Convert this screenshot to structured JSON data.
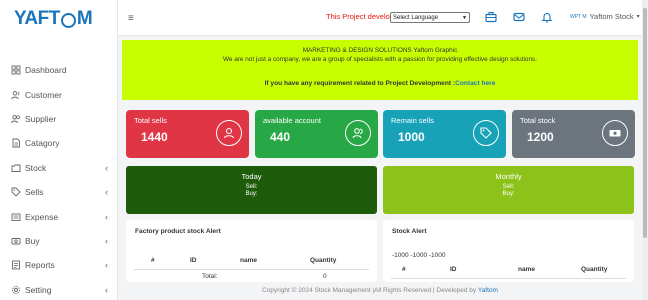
{
  "brand": {
    "logo_pre": "YAFT",
    "logo_post": "M"
  },
  "sidebar": {
    "items": [
      {
        "label": "Dashboard",
        "icon": "dashboard-icon",
        "has_chevron": false
      },
      {
        "label": "Customer",
        "icon": "customer-icon",
        "has_chevron": false
      },
      {
        "label": "Supplier",
        "icon": "supplier-icon",
        "has_chevron": false
      },
      {
        "label": "Catagory",
        "icon": "category-icon",
        "has_chevron": false
      },
      {
        "label": "Stock",
        "icon": "stock-icon",
        "has_chevron": true
      },
      {
        "label": "Sells",
        "icon": "tag-icon",
        "has_chevron": true
      },
      {
        "label": "Expense",
        "icon": "expense-icon",
        "has_chevron": true
      },
      {
        "label": "Buy",
        "icon": "buy-icon",
        "has_chevron": true
      },
      {
        "label": "Reports",
        "icon": "reports-icon",
        "has_chevron": true
      },
      {
        "label": "Setting",
        "icon": "gear-icon",
        "has_chevron": true
      }
    ],
    "chevron": "‹"
  },
  "topbar": {
    "menu_glyph": "≡",
    "marquee": "This Project develope",
    "language_select": "Select Language",
    "user_tag": "WPT M",
    "user_name": "Yaftom Stock",
    "caret": "▾"
  },
  "banner": {
    "line1": "MARKETING & DESIGN SOLUTIONS Yaftom Graphic",
    "line2": "We are not just a company, we are a group of specialists with a passion for providing effective design solutions.",
    "line3_prefix": "If you have any requirement related to Project Development :",
    "line3_link": "Contact here"
  },
  "cards": [
    {
      "title": "Total sells",
      "value": "1440",
      "color": "#e03545"
    },
    {
      "title": "available account",
      "value": "440",
      "color": "#27a745"
    },
    {
      "title": "Remain sells",
      "value": "1000",
      "color": "#17a2b8"
    },
    {
      "title": "Total stock",
      "value": "1200",
      "color": "#6c757d"
    }
  ],
  "today": {
    "title": "Today",
    "sell": "Sell:",
    "buy": "Buy:",
    "color": "#1e5c0c"
  },
  "monthly": {
    "title": "Monthly",
    "sell": "Sell:",
    "buy": "Buy:",
    "color": "#8cc21a"
  },
  "factory_panel": {
    "title": "Factory product stock Alert",
    "columns": [
      "#",
      "ID",
      "name",
      "Quantity"
    ],
    "total_label": "Total:",
    "total_value": "0"
  },
  "stock_panel": {
    "title": "Stock Alert",
    "values_line": "-1000 -1000 -1000",
    "columns": [
      "#",
      "ID",
      "name",
      "Quantity"
    ]
  },
  "footer": {
    "text": "Copyright © 2024 Stock Management |All Rights Reserved | Developed by ",
    "link": "Yaftom"
  }
}
